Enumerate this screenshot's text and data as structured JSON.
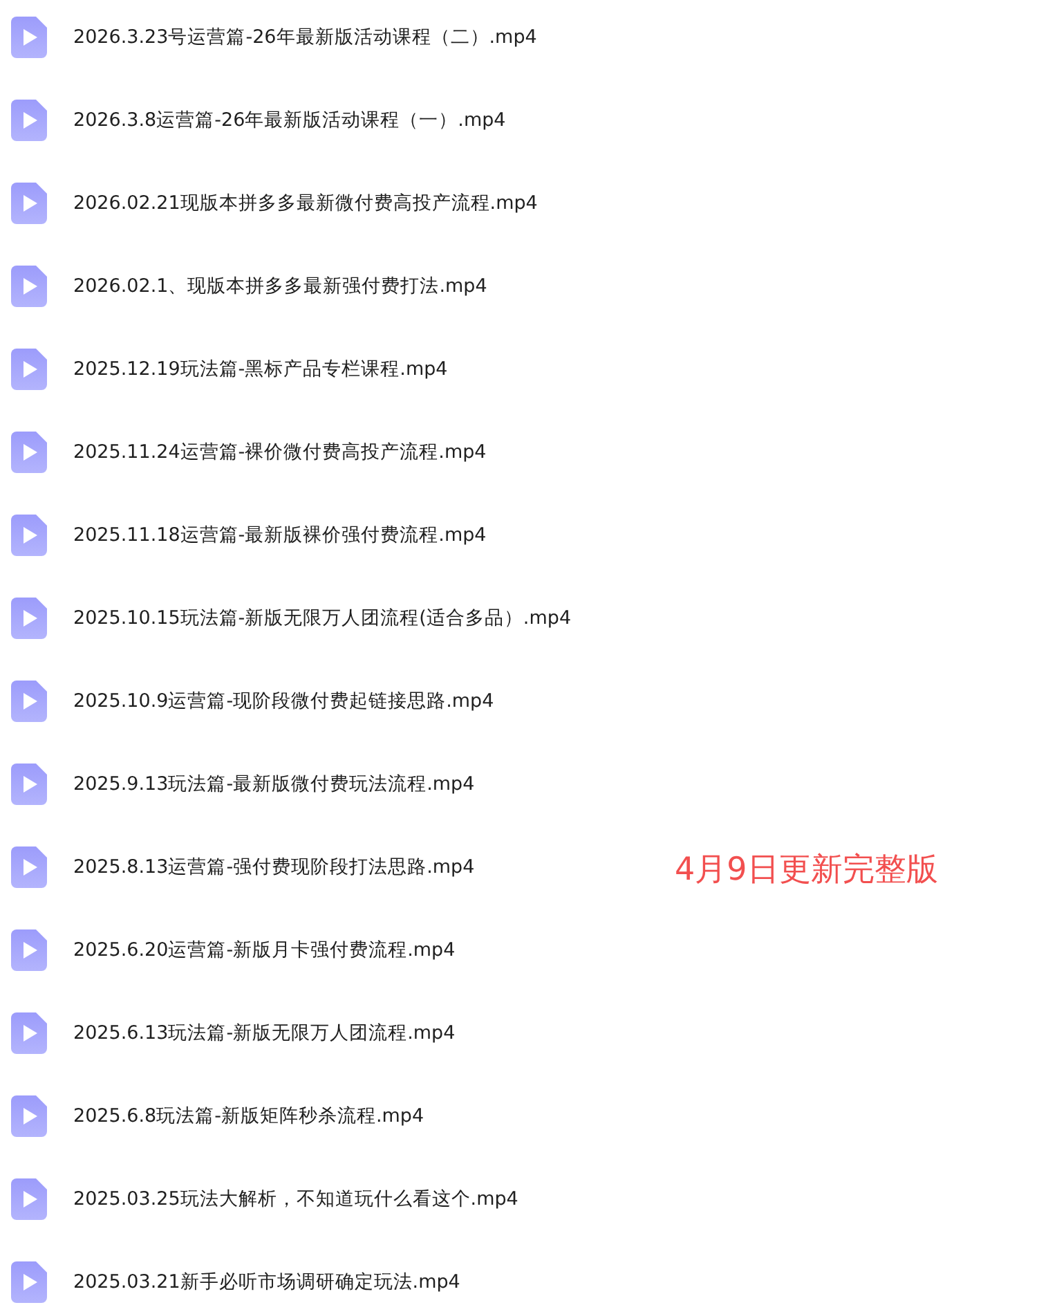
{
  "files": [
    {
      "name": "2026.3.23号运营篇-26年最新版活动课程（二）.mp4"
    },
    {
      "name": "2026.3.8运营篇-26年最新版活动课程（一）.mp4"
    },
    {
      "name": "2026.02.21现版本拼多多最新微付费高投产流程.mp4"
    },
    {
      "name": "2026.02.1、现版本拼多多最新强付费打法.mp4"
    },
    {
      "name": "2025.12.19玩法篇-黑标产品专栏课程.mp4"
    },
    {
      "name": "2025.11.24运营篇-裸价微付费高投产流程.mp4"
    },
    {
      "name": "2025.11.18运营篇-最新版裸价强付费流程.mp4"
    },
    {
      "name": "2025.10.15玩法篇-新版无限万人团流程(适合多品）.mp4"
    },
    {
      "name": "2025.10.9运营篇-现阶段微付费起链接思路.mp4"
    },
    {
      "name": "2025.9.13玩法篇-最新版微付费玩法流程.mp4"
    },
    {
      "name": "2025.8.13运营篇-强付费现阶段打法思路.mp4"
    },
    {
      "name": "2025.6.20运营篇-新版月卡强付费流程.mp4"
    },
    {
      "name": "2025.6.13玩法篇-新版无限万人团流程.mp4"
    },
    {
      "name": "2025.6.8玩法篇-新版矩阵秒杀流程.mp4"
    },
    {
      "name": "2025.03.25玩法大解析，不知道玩什么看这个.mp4"
    },
    {
      "name": "2025.03.21新手必听市场调研确定玩法.mp4"
    }
  ],
  "note": "4月9日更新完整版"
}
